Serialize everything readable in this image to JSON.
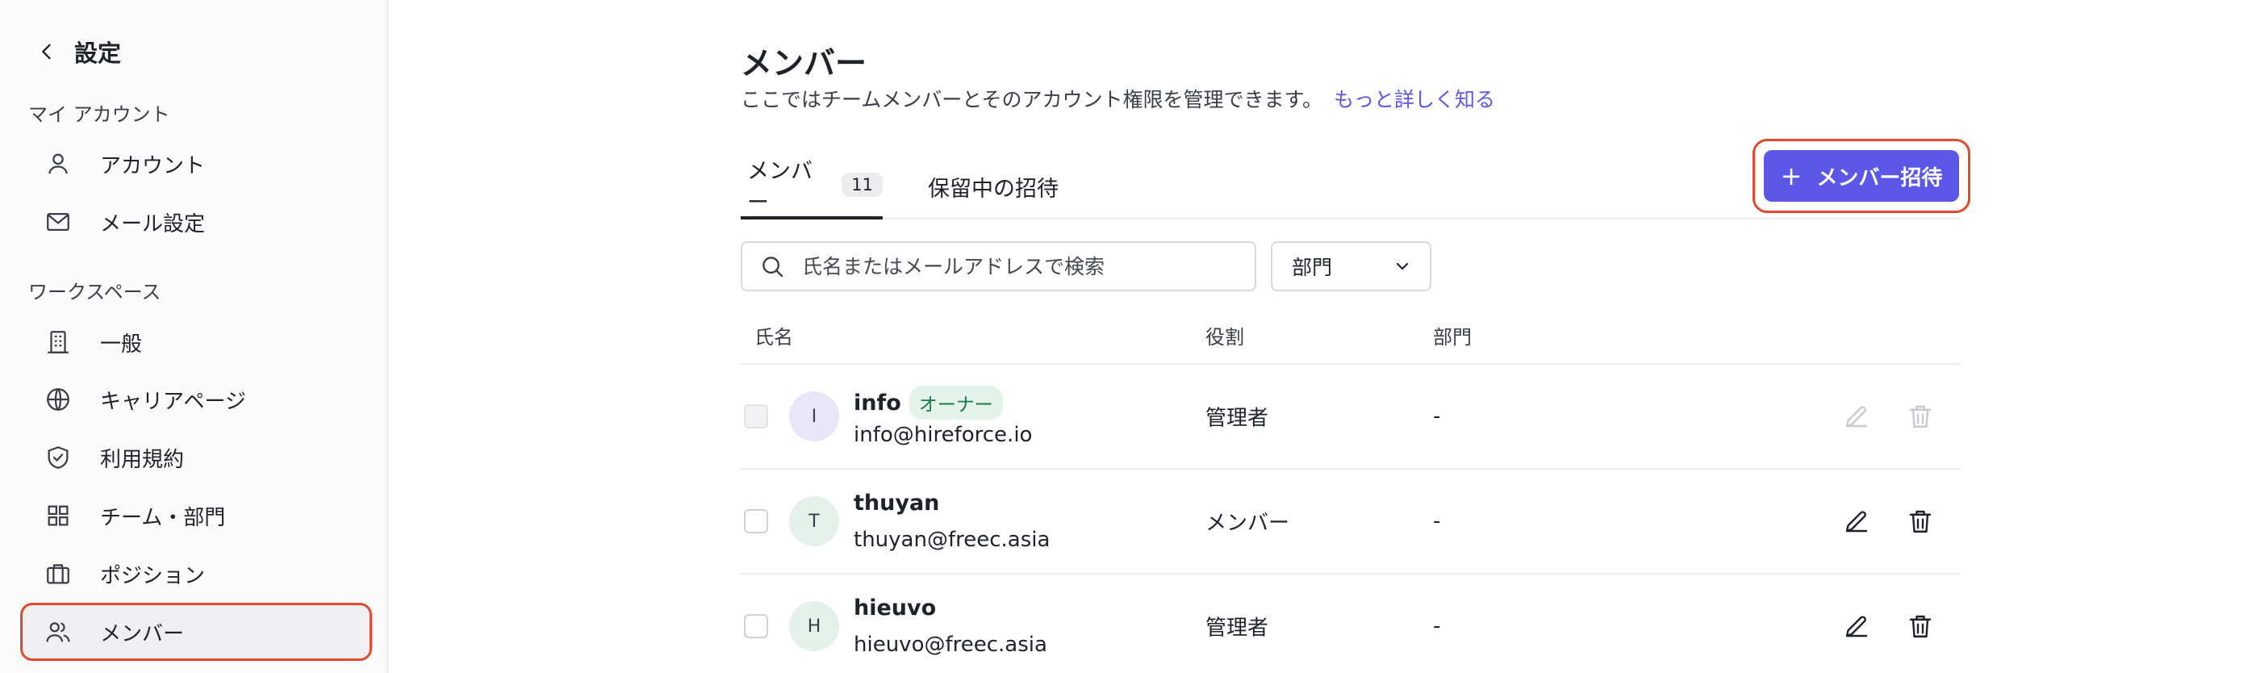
{
  "sidebar": {
    "back_label": "設定",
    "account_section": "マイ アカウント",
    "workspace_section": "ワークスペース",
    "items": [
      {
        "label": "アカウント",
        "icon": "user-icon"
      },
      {
        "label": "メール設定",
        "icon": "mail-icon"
      },
      {
        "label": "一般",
        "icon": "building-icon"
      },
      {
        "label": "キャリアページ",
        "icon": "globe-icon"
      },
      {
        "label": "利用規約",
        "icon": "shield-check-icon"
      },
      {
        "label": "チーム・部門",
        "icon": "grid-icon"
      },
      {
        "label": "ポジション",
        "icon": "briefcase-icon"
      },
      {
        "label": "メンバー",
        "icon": "users-icon",
        "active": true
      }
    ]
  },
  "main": {
    "title": "メンバー",
    "subtitle": "ここではチームメンバーとそのアカウント権限を管理できます。",
    "learn_more": "もっと詳しく知る",
    "tabs": [
      {
        "label": "メンバー",
        "count": "11"
      },
      {
        "label": "保留中の招待"
      }
    ],
    "invite_button": "メンバー招待",
    "search_placeholder": "氏名またはメールアドレスで検索",
    "dept_filter": "部門",
    "columns": {
      "name": "氏名",
      "role": "役割",
      "dept": "部門"
    },
    "members": [
      {
        "initial": "I",
        "name": "info",
        "badge": "オーナー",
        "email": "info@hireforce.io",
        "role": "管理者",
        "dept": "-",
        "avatar_color": "#e9e6f7"
      },
      {
        "initial": "T",
        "name": "thuyan",
        "badge": "",
        "email": "thuyan@freec.asia",
        "role": "メンバー",
        "dept": "-",
        "avatar_color": "#e4f0ea"
      },
      {
        "initial": "H",
        "name": "hieuvo",
        "badge": "",
        "email": "hieuvo@freec.asia",
        "role": "管理者",
        "dept": "-",
        "avatar_color": "#e4f0ea"
      }
    ]
  },
  "colors": {
    "accent": "#5b57e8",
    "highlight": "#e2492e",
    "owner_badge_bg": "#e4f3ea",
    "owner_badge_text": "#1b7a4a"
  }
}
